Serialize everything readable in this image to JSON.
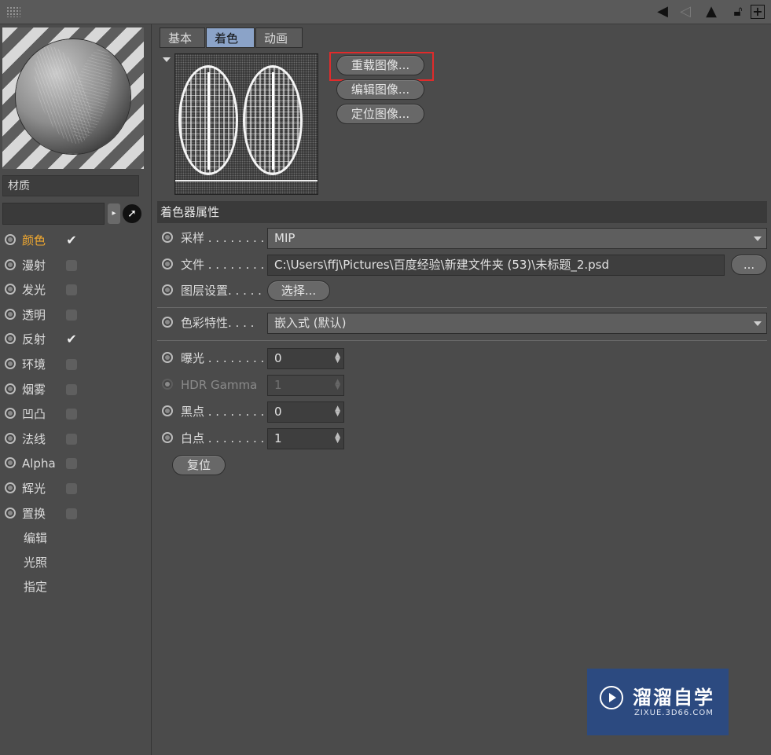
{
  "toolbar": {
    "icons": [
      "back-arrow-icon",
      "forward-arrow-icon",
      "up-arrow-icon",
      "lock-icon",
      "new-window-icon"
    ]
  },
  "material": {
    "name": "材质",
    "search_value": "",
    "channels": [
      {
        "label": "颜色",
        "checked": true,
        "active": true
      },
      {
        "label": "漫射",
        "checked": false
      },
      {
        "label": "发光",
        "checked": false
      },
      {
        "label": "透明",
        "checked": false
      },
      {
        "label": "反射",
        "checked": true
      },
      {
        "label": "环境",
        "checked": false
      },
      {
        "label": "烟雾",
        "checked": false
      },
      {
        "label": "凹凸",
        "checked": false
      },
      {
        "label": "法线",
        "checked": false
      },
      {
        "label": "Alpha",
        "checked": false
      },
      {
        "label": "辉光",
        "checked": false
      },
      {
        "label": "置换",
        "checked": false
      }
    ],
    "subitems": [
      "编辑",
      "光照",
      "指定"
    ]
  },
  "tabs": [
    "基本",
    "着色器",
    "动画"
  ],
  "selected_tab": "着色器",
  "image_buttons": {
    "reload": "重载图像...",
    "edit": "编辑图像...",
    "locate": "定位图像..."
  },
  "shader": {
    "section_title": "着色器属性",
    "sampling": {
      "label": "采样 . . . . . . . .",
      "value": "MIP"
    },
    "file": {
      "label": "文件 . . . . . . . .",
      "value": "C:\\Users\\ffj\\Pictures\\百度经验\\新建文件夹 (53)\\未标题_2.psd",
      "browse": "..."
    },
    "layer": {
      "label": "图层设置. . . . .",
      "button": "选择..."
    },
    "color_profile": {
      "label": "色彩特性. . . .",
      "value": "嵌入式 (默认)"
    },
    "exposure": {
      "label": "曝光 . . . . . . . .",
      "value": "0"
    },
    "hdr_gamma": {
      "label": "HDR Gamma",
      "value": "1"
    },
    "black_point": {
      "label": "黑点 . . . . . . . .",
      "value": "0"
    },
    "white_point": {
      "label": "白点 . . . . . . . .",
      "value": "1"
    },
    "reset": "复位"
  },
  "watermark": {
    "title": "溜溜自学",
    "subtitle": "ZIXUE.3D66.COM"
  },
  "colors": {
    "highlight": "#e02b2b",
    "active_channel": "#f0a830",
    "selected_tab": "#8ba3c8"
  }
}
